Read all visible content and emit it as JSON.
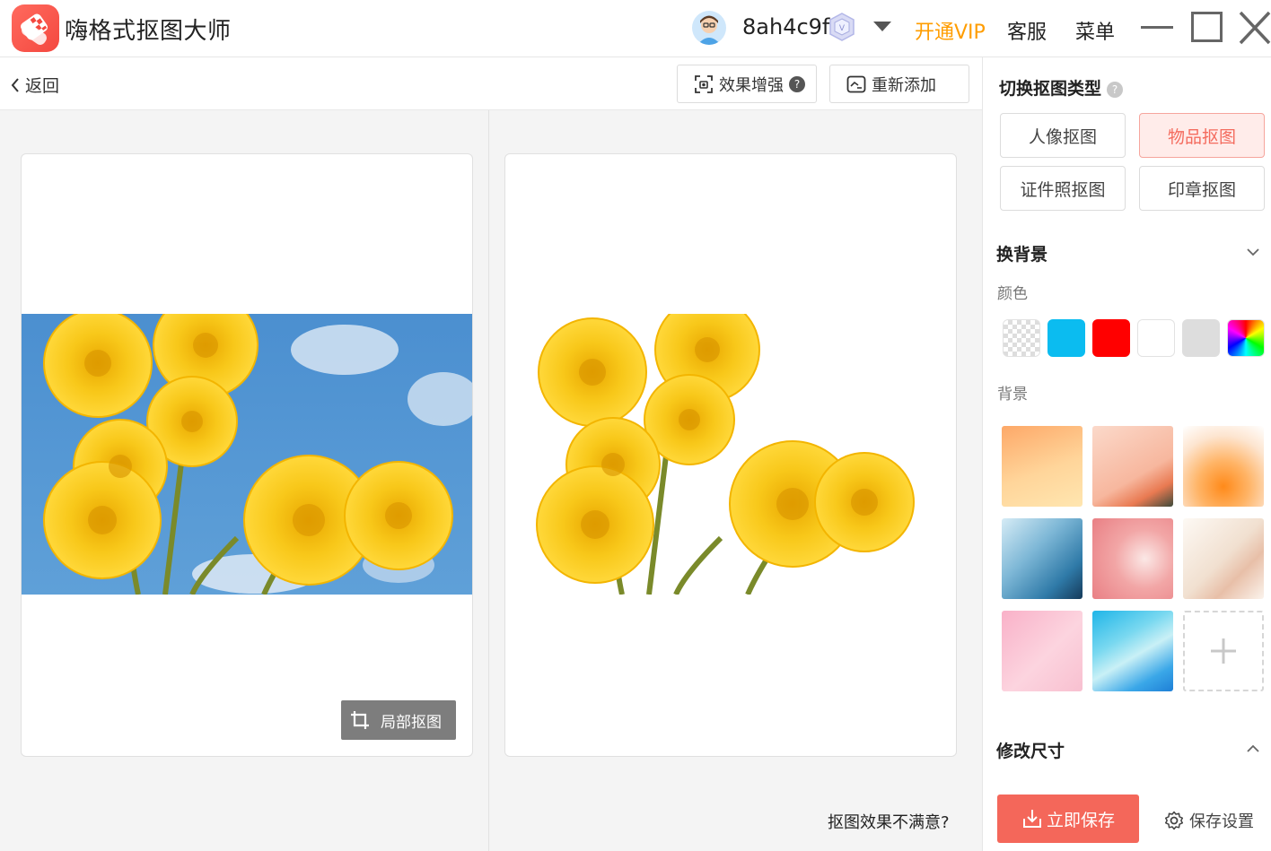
{
  "app": {
    "title": "嗨格式抠图大师"
  },
  "user": {
    "name": "8ah4c9f"
  },
  "header": {
    "open_vip": "开通VIP",
    "service": "客服",
    "menu": "菜单"
  },
  "toolbar": {
    "back": "返回",
    "enhance": "效果增强",
    "readd": "重新添加"
  },
  "workspace": {
    "crop_label": "局部抠图",
    "unsatisfied": "抠图效果不满意?"
  },
  "sidebar": {
    "type_title": "切换抠图类型",
    "types": [
      {
        "label": "人像抠图",
        "active": false
      },
      {
        "label": "物品抠图",
        "active": true
      },
      {
        "label": "证件照抠图",
        "active": false
      },
      {
        "label": "印章抠图",
        "active": false
      }
    ],
    "bg_title": "换背景",
    "color_label": "颜色",
    "colors": [
      "transparent",
      "#0bbcf0",
      "#ff0000",
      "#ffffff",
      "#dddddd",
      "rainbow"
    ],
    "background_label": "背景",
    "resize_title": "修改尺寸",
    "save": "立即保存",
    "save_settings": "保存设置"
  },
  "theme": {
    "accent": "#f4675a",
    "vip_color": "#ff9d00"
  }
}
